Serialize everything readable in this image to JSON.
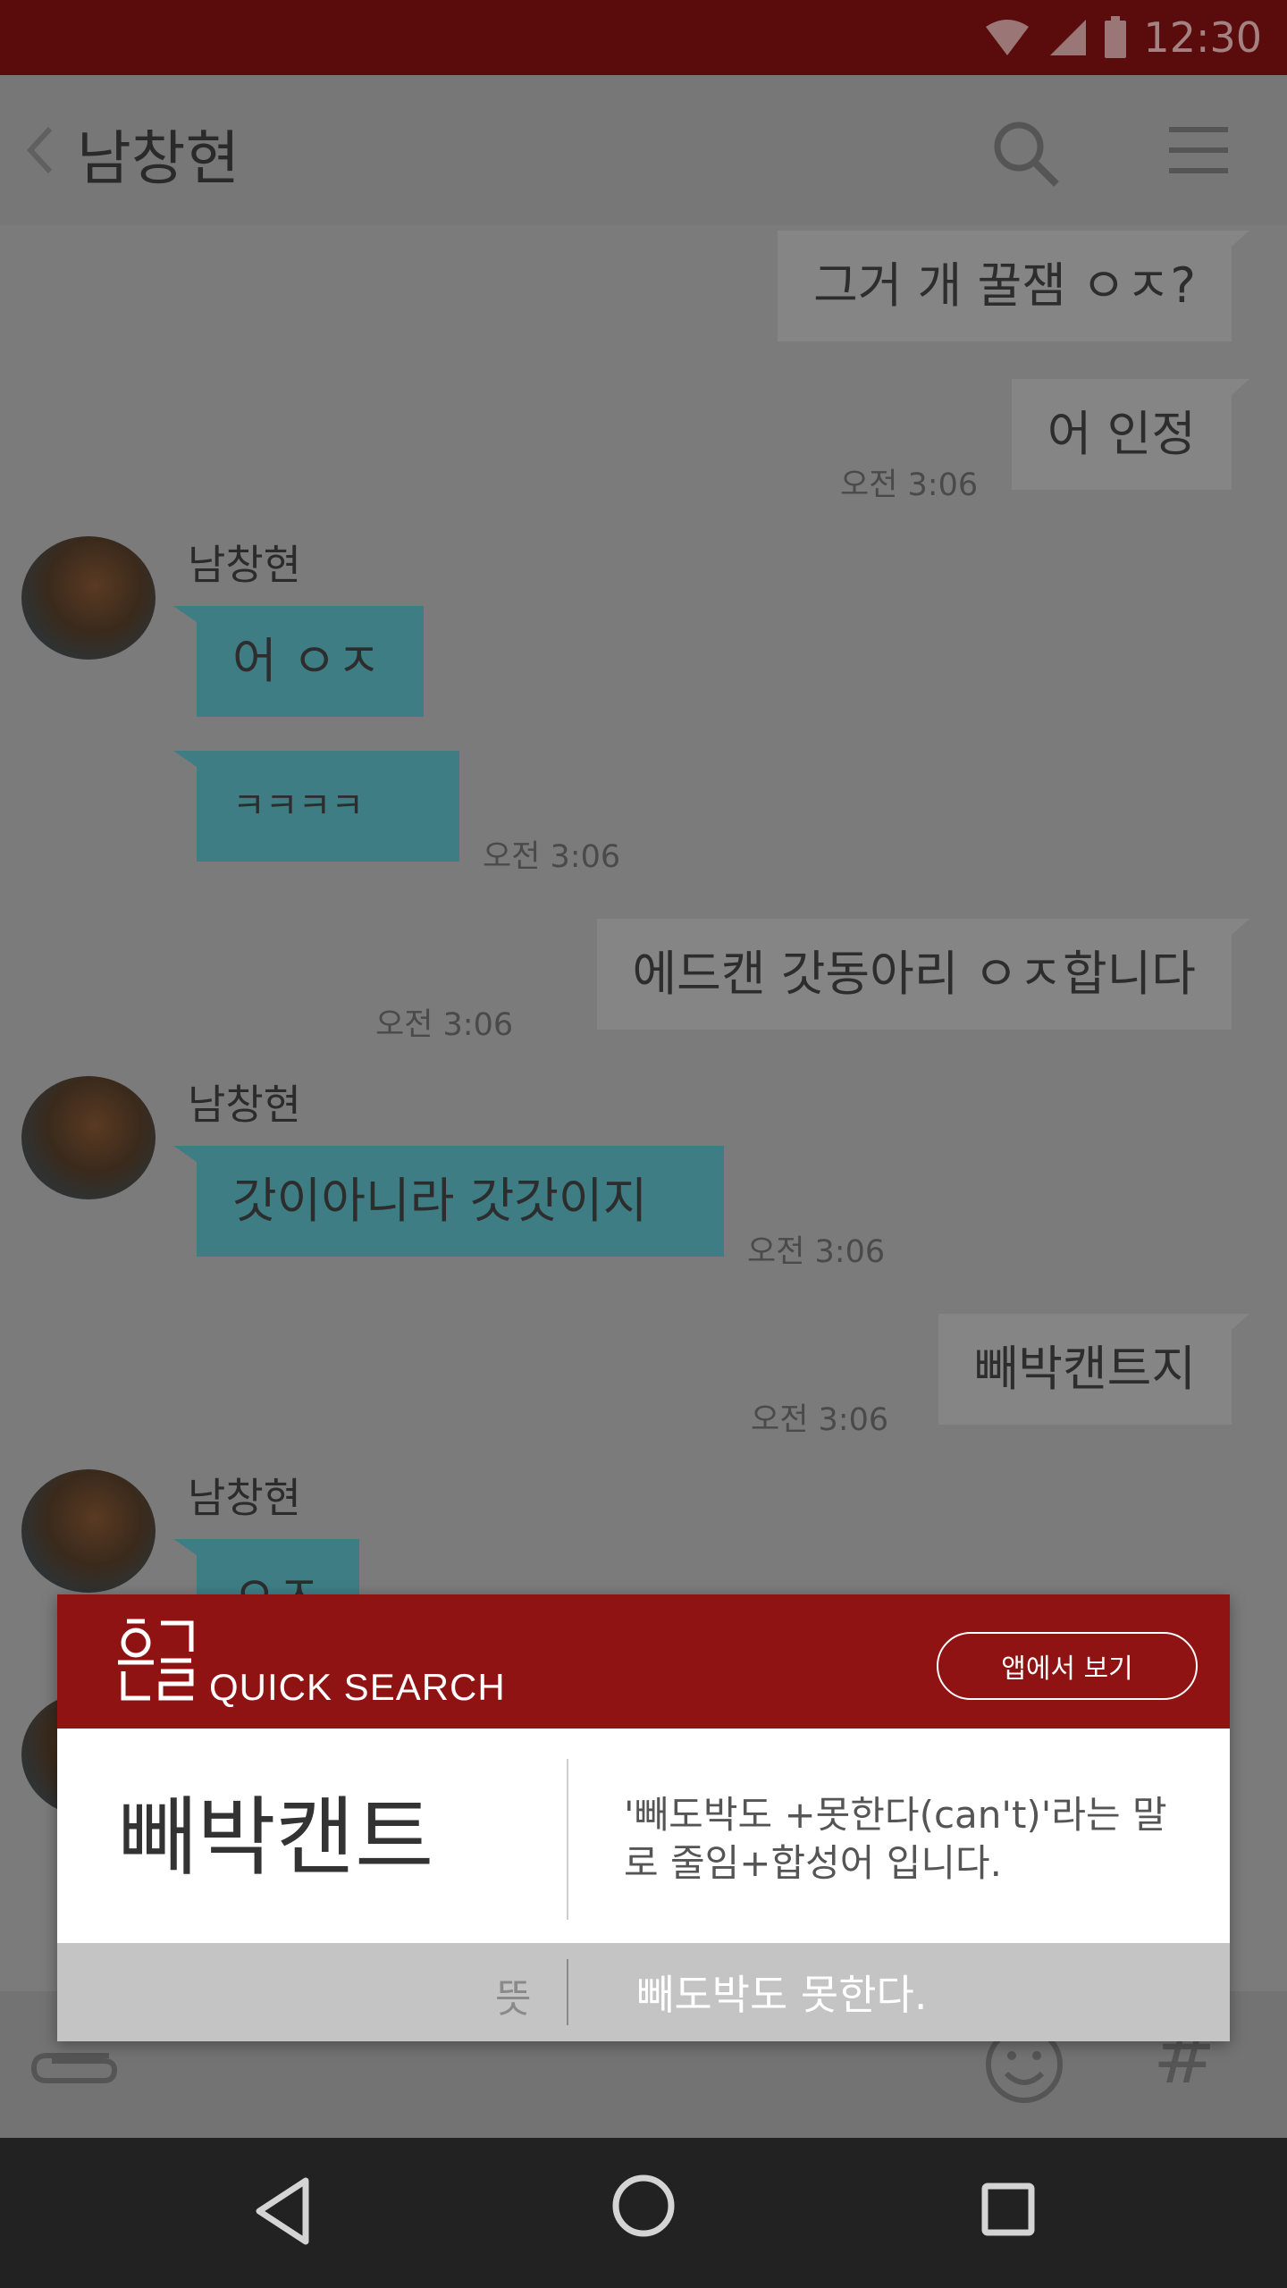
{
  "status_bar": {
    "time": "12:30",
    "icons": [
      "wifi-icon",
      "signal-icon",
      "battery-icon"
    ]
  },
  "header": {
    "title": "남창현",
    "icons": [
      "back-icon",
      "search-icon",
      "menu-icon"
    ]
  },
  "messages": [
    {
      "side": "out",
      "text": "그거 개 꿀잼 ㅇㅈ?"
    },
    {
      "side": "out",
      "text": "어 인정",
      "time": "오전 3:06"
    },
    {
      "side": "in",
      "sender": "남창현",
      "text": "어 ㅇㅈ"
    },
    {
      "side": "in",
      "text": "ㅋㅋㅋㅋ",
      "time": "오전 3:06"
    },
    {
      "side": "out",
      "text": "에드캔 갓동아리 ㅇㅈ합니다",
      "time": "오전 3:06"
    },
    {
      "side": "in",
      "sender": "남창현",
      "text": "갓이아니라 갓갓이지",
      "time": "오전 3:06"
    },
    {
      "side": "out",
      "text": "빼박캔트지",
      "time": "오전 3:06"
    },
    {
      "side": "in",
      "sender": "남창현",
      "text": "ㅇㅈ"
    }
  ],
  "input_bar": {
    "icons": [
      "attach-icon",
      "emoji-icon"
    ],
    "hash": "#"
  },
  "popup": {
    "brand": "QUICK SEARCH",
    "open_app_label": "앱에서 보기",
    "word": "빼박캔트",
    "definition": "'빼도박도 +못한다(can't)'라는 말로 줄임+합성어 입니다.",
    "meaning_label": "뜻",
    "meaning_value": "빼도박도 못한다."
  },
  "colors": {
    "brand": "#901313",
    "status_bar": "#5a0c0c",
    "incoming_bubble": "#3f7d85",
    "nav_bar": "#222222"
  }
}
